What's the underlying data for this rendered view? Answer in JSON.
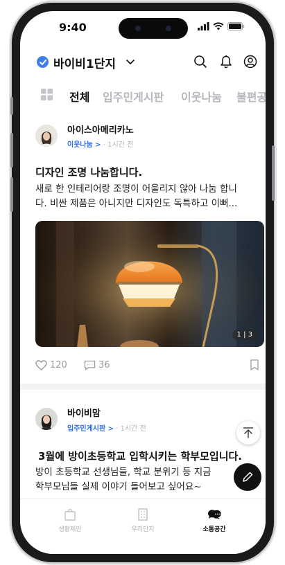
{
  "status_bar": {
    "time": "9:40"
  },
  "header": {
    "complex_name": "바이비1단지"
  },
  "tabs": [
    {
      "label": "전체",
      "active": true
    },
    {
      "label": "입주민게시판",
      "active": false
    },
    {
      "label": "이웃나눔",
      "active": false
    },
    {
      "label": "불편공감",
      "active": false
    }
  ],
  "posts": [
    {
      "author": "아이스아메리카노",
      "category": "이웃나눔 >",
      "separator": "·",
      "time_ago": "1시간 전",
      "title": "디자인 조명 나눔합니다.",
      "body_lines": [
        "새로 한 인테리어랑 조명이 어울리지 않아 나눔 합니",
        "다. 비싼 제품은 아니지만 디자인도 독특하고 이뻐..."
      ],
      "photo_counter": "1 | 3",
      "likes": "120",
      "comments": "36"
    },
    {
      "author": "바이비맘",
      "category": "입주민게시판 >",
      "separator": "·",
      "time_ago": "1시간 전",
      "title": "3월에 방이초등학교 입학시키는 학부모입니다.",
      "body_lines": [
        "방이 초등학교 선생님들, 학교 분위기 등 지금",
        "학부모님들 실제 이야기 들어보고 싶어요~"
      ]
    }
  ],
  "bottom_nav": [
    {
      "label": "생활제안",
      "icon": "shopping-bag-icon",
      "active": false
    },
    {
      "label": "우리단지",
      "icon": "building-icon",
      "active": false
    },
    {
      "label": "소통공간",
      "icon": "chat-bubbles-icon",
      "active": true
    }
  ],
  "colors": {
    "accent_blue": "#2d6ee6",
    "badge_blue": "#3f7ee8",
    "text_dark": "#111111",
    "text_muted": "#b5b7bc"
  }
}
